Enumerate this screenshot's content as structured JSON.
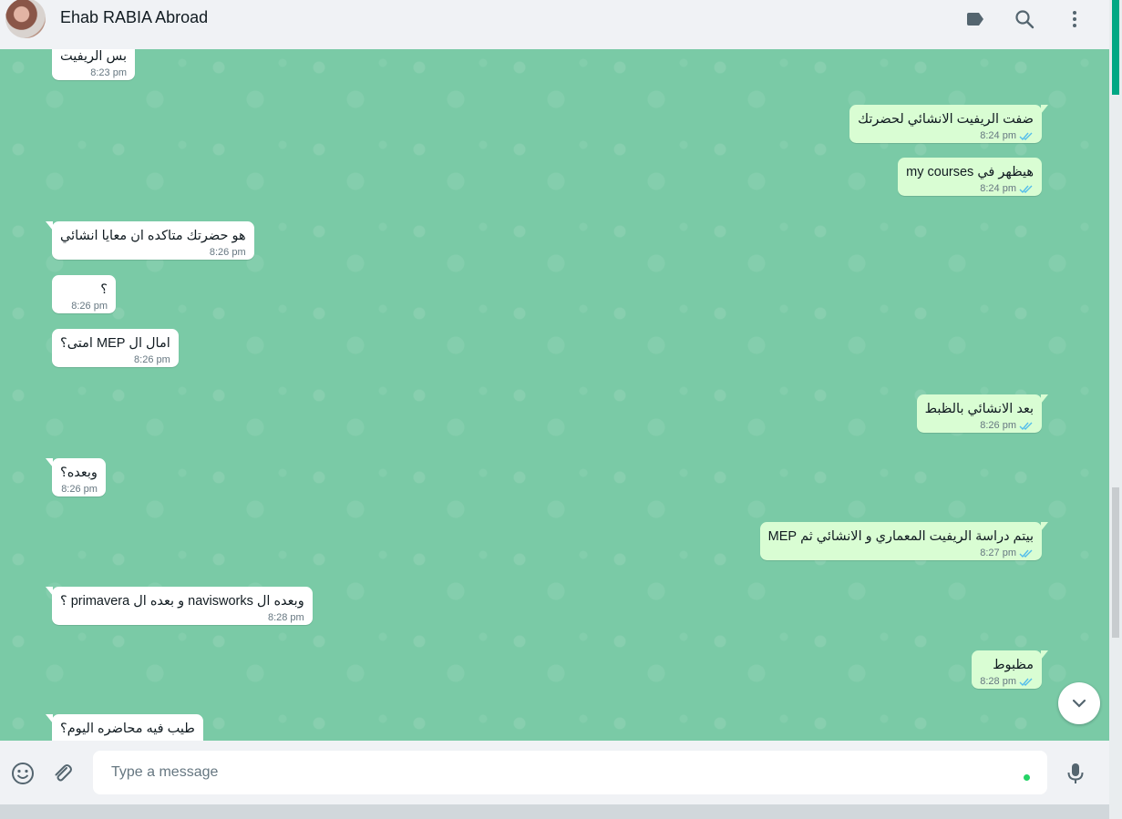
{
  "header": {
    "contact_name": "Ehab RABIA Abroad",
    "icons": [
      "label-icon",
      "search-icon",
      "menu-icon"
    ]
  },
  "messages": [
    {
      "dir": "in",
      "text": "بس الريفيت",
      "time": "8:23 pm"
    },
    {
      "dir": "out",
      "text": "ضفت الريفيت الانشائي لحضرتك",
      "time": "8:24 pm",
      "status": "read"
    },
    {
      "dir": "out",
      "text": "هيظهر في my courses",
      "time": "8:24 pm",
      "status": "read"
    },
    {
      "dir": "in",
      "text": "هو حضرتك متاكده ان معايا انشائي",
      "time": "8:26 pm"
    },
    {
      "dir": "in",
      "text": "؟",
      "time": "8:26 pm"
    },
    {
      "dir": "in",
      "text": "امال ال MEP امتى؟",
      "time": "8:26 pm"
    },
    {
      "dir": "out",
      "text": "بعد الانشائي بالظبط",
      "time": "8:26 pm",
      "status": "read"
    },
    {
      "dir": "in",
      "text": "وبعده؟",
      "time": "8:26 pm"
    },
    {
      "dir": "out",
      "text": "بيتم دراسة الريفيت المعماري و الانشائي ثم MEP",
      "time": "8:27 pm",
      "status": "read"
    },
    {
      "dir": "in",
      "text": "وبعده ال navisworks و بعده ال primavera ؟",
      "time": "8:28 pm"
    },
    {
      "dir": "out",
      "text": "مظبوط",
      "time": "8:28 pm",
      "status": "read"
    },
    {
      "dir": "in",
      "text": "طيب فيه محاضره اليوم؟",
      "time": ""
    }
  ],
  "composer": {
    "placeholder": "Type a message"
  },
  "colors": {
    "chat_bg": "#7acaa6",
    "incoming": "#ffffff",
    "outgoing": "#d9fdd3",
    "read_ticks": "#53bdeb",
    "accent": "#00a884"
  }
}
